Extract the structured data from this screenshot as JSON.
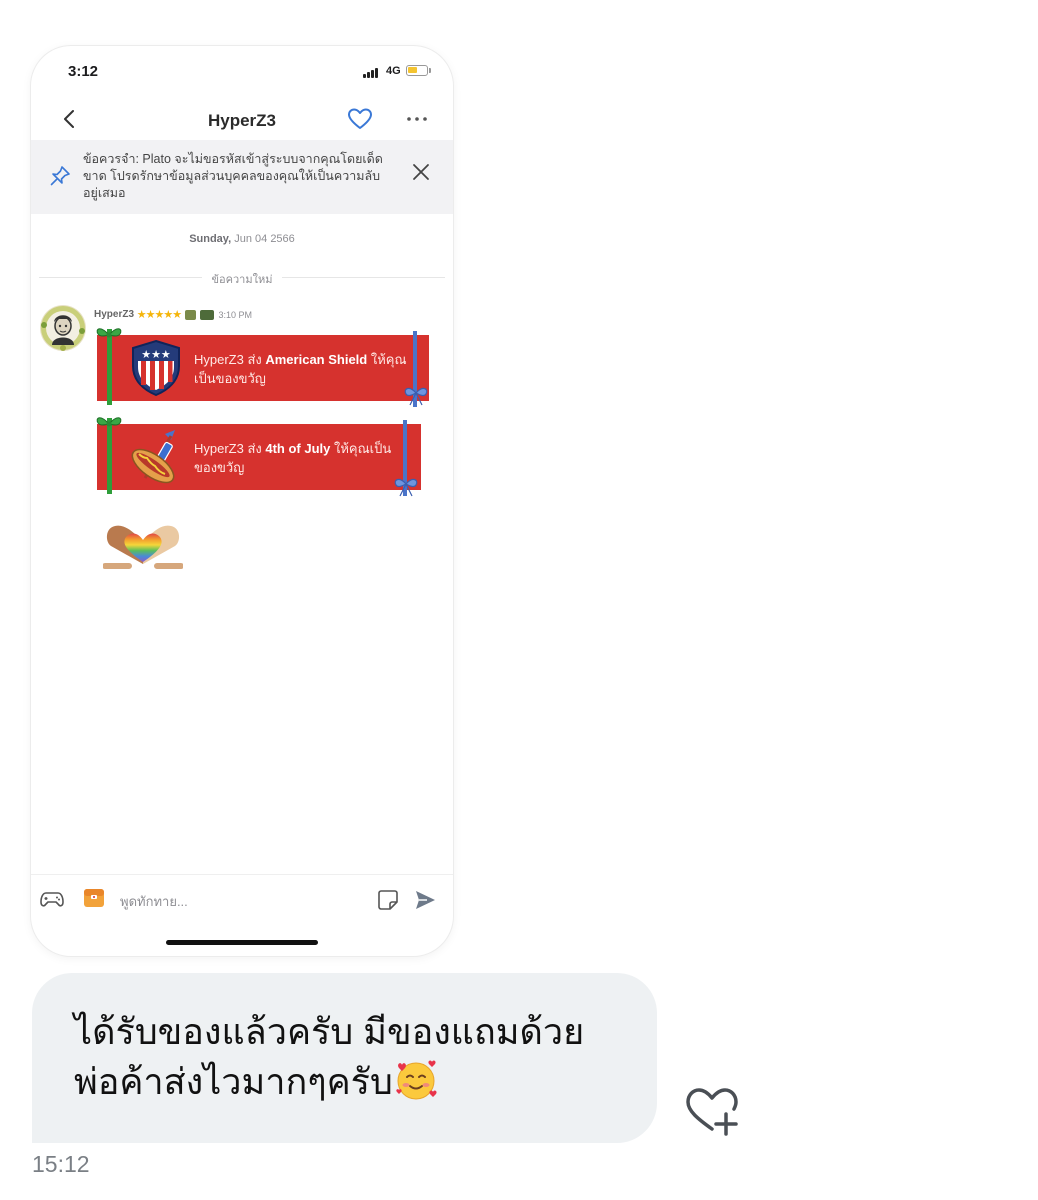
{
  "phone": {
    "status_time": "3:12",
    "network": "4G",
    "battery_level": 0.55,
    "title": "HyperZ3",
    "notice": "ข้อควรจำ: Plato จะไม่ขอรหัสเข้าสู่ระบบจากคุณโดยเด็ดขาด โปรดรักษาข้อมูลส่วนบุคคลของคุณให้เป็นความลับอยู่เสมอ",
    "date_day": "Sunday,",
    "date_rest": "Jun 04 2566",
    "new_messages_label": "ข้อความใหม่",
    "sender": {
      "name": "HyperZ3",
      "stars": "★★★★★",
      "star_count": 5,
      "time": "3:10 PM"
    },
    "gifts": [
      {
        "prefix": "HyperZ3 ส่ง ",
        "item": "American Shield",
        "suffix": " ให้คุณเป็นของขวัญ",
        "icon": "american-shield-icon"
      },
      {
        "prefix": "HyperZ3 ส่ง ",
        "item": "4th of July",
        "suffix": " ให้คุณเป็นของขวัญ",
        "icon": "hotdog-firework-icon"
      }
    ],
    "sticker": "rainbow-heart-hands-sticker",
    "input_placeholder": "พูดทักทาย..."
  },
  "bubble": {
    "line1": "ได้รับของแล้วครับ มีของแถมด้วย",
    "line2": "พ่อค้าส่งไวมากๆครับ",
    "emoji": "smiling-face-with-hearts-emoji"
  },
  "time": "15:12",
  "colors": {
    "gift_red": "#d6322e",
    "bubble_bg": "#eef1f3",
    "accent_blue": "#3a78d6",
    "ribbon_green": "#2e9e3a"
  }
}
